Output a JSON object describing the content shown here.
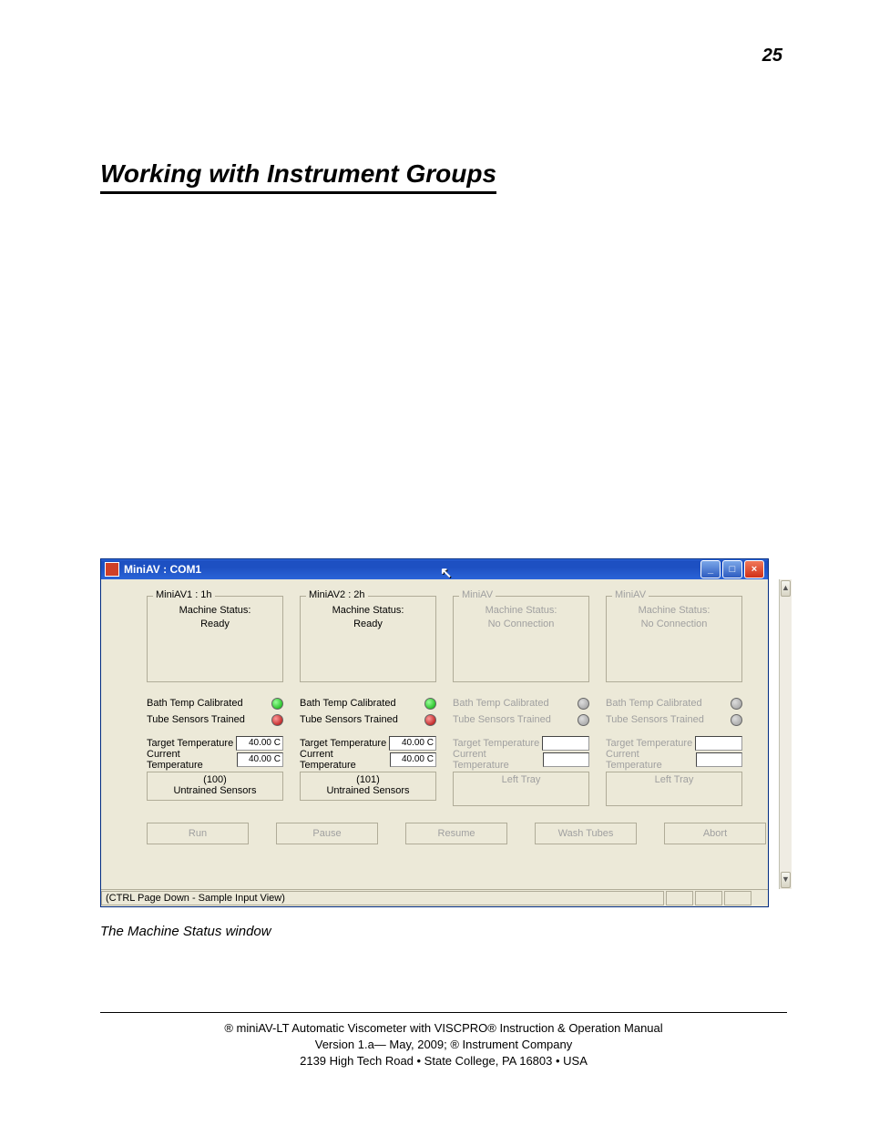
{
  "page_number": "25",
  "heading": "Working with Instrument Groups",
  "caption": "The Machine Status window",
  "footer": {
    "line1": "® miniAV-LT Automatic Viscometer with VISCPRO® Instruction & Operation Manual",
    "line2": "Version 1.a— May, 2009;            ® Instrument Company",
    "line3": "2139 High Tech Road • State College, PA  16803 • USA"
  },
  "window": {
    "title": "MiniAV : COM1",
    "statusbar": "(CTRL Page Down - Sample Input View)",
    "labels": {
      "machine_status": "Machine Status:",
      "bath_temp_calibrated": "Bath Temp Calibrated",
      "tube_sensors_trained": "Tube Sensors Trained",
      "target_temp": "Target Temperature",
      "current_temp": "Current Temperature",
      "untrained_sensors": "Untrained Sensors",
      "left_tray": "Left Tray"
    },
    "buttons": {
      "run": "Run",
      "pause": "Pause",
      "resume": "Resume",
      "wash_tubes": "Wash Tubes",
      "abort": "Abort"
    },
    "panels": [
      {
        "legend": "MiniAV1 : 1h",
        "status": "Ready",
        "bath_led": "green",
        "tube_led": "red",
        "target_temp": "40.00 C",
        "current_temp": "40.00 C",
        "sub_id": "(100)",
        "sub_label": "Untrained Sensors",
        "disabled": false,
        "show_temps": true
      },
      {
        "legend": "MiniAV2 : 2h",
        "status": "Ready",
        "bath_led": "green",
        "tube_led": "red",
        "target_temp": "40.00 C",
        "current_temp": "40.00 C",
        "sub_id": "(101)",
        "sub_label": "Untrained Sensors",
        "disabled": false,
        "show_temps": true
      },
      {
        "legend": "MiniAV",
        "status": "No Connection",
        "bath_led": "gray",
        "tube_led": "gray",
        "target_temp": "",
        "current_temp": "",
        "sub_id": "",
        "sub_label": "Left Tray",
        "disabled": true,
        "show_temps": false
      },
      {
        "legend": "MiniAV",
        "status": "No Connection",
        "bath_led": "gray",
        "tube_led": "gray",
        "target_temp": "",
        "current_temp": "",
        "sub_id": "",
        "sub_label": "Left Tray",
        "disabled": true,
        "show_temps": false
      }
    ]
  }
}
